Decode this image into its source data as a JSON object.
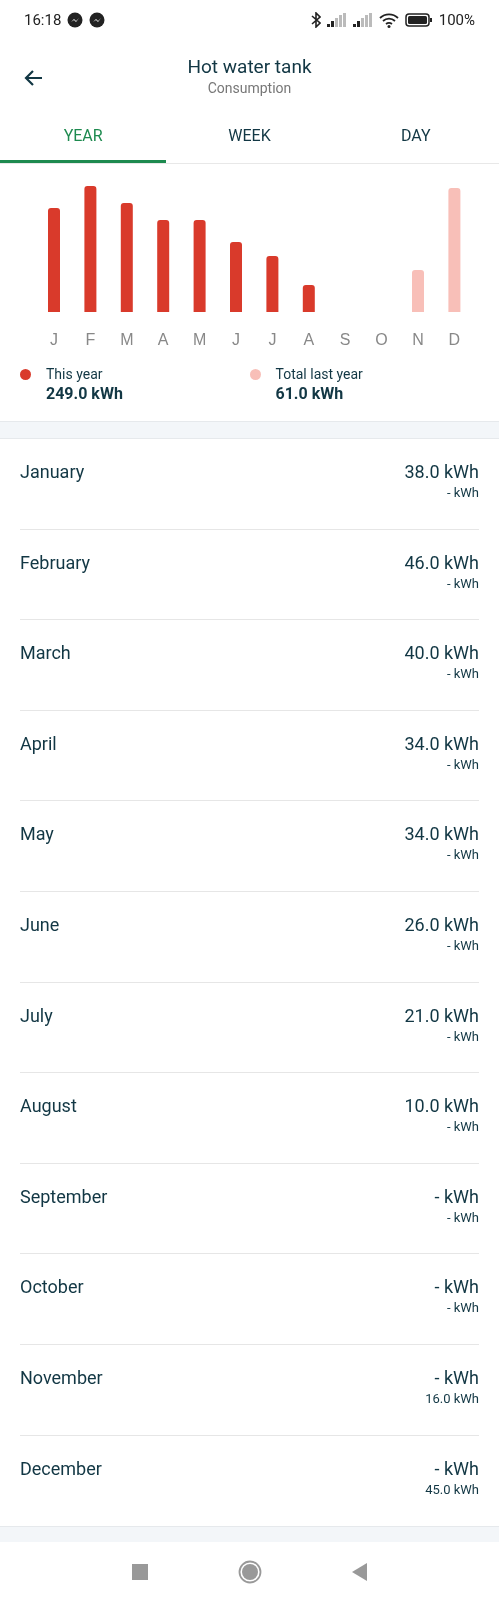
{
  "status_bar": {
    "time": "16:18",
    "battery": "100%"
  },
  "header": {
    "title": "Hot water tank",
    "subtitle": "Consumption"
  },
  "tabs": [
    {
      "label": "YEAR",
      "selected": true
    },
    {
      "label": "WEEK",
      "selected": false
    },
    {
      "label": "DAY",
      "selected": false
    }
  ],
  "chart": {
    "month_labels": [
      "J",
      "F",
      "M",
      "A",
      "M",
      "J",
      "J",
      "A",
      "S",
      "O",
      "N",
      "D"
    ]
  },
  "legend": [
    {
      "label": "This year",
      "value": "249.0 kWh",
      "color": "#d93a2b"
    },
    {
      "label": "Total last year",
      "value": "61.0 kWh",
      "color": "#f8bfb8"
    }
  ],
  "months": [
    {
      "name": "January",
      "value": "38.0 kWh",
      "last_year": "- kWh"
    },
    {
      "name": "February",
      "value": "46.0 kWh",
      "last_year": "- kWh"
    },
    {
      "name": "March",
      "value": "40.0 kWh",
      "last_year": "- kWh"
    },
    {
      "name": "April",
      "value": "34.0 kWh",
      "last_year": "- kWh"
    },
    {
      "name": "May",
      "value": "34.0 kWh",
      "last_year": "- kWh"
    },
    {
      "name": "June",
      "value": "26.0 kWh",
      "last_year": "- kWh"
    },
    {
      "name": "July",
      "value": "21.0 kWh",
      "last_year": "- kWh"
    },
    {
      "name": "August",
      "value": "10.0 kWh",
      "last_year": "- kWh"
    },
    {
      "name": "September",
      "value": "- kWh",
      "last_year": "- kWh"
    },
    {
      "name": "October",
      "value": "- kWh",
      "last_year": "- kWh"
    },
    {
      "name": "November",
      "value": "- kWh",
      "last_year": "16.0 kWh"
    },
    {
      "name": "December",
      "value": "- kWh",
      "last_year": "45.0 kWh"
    }
  ]
}
